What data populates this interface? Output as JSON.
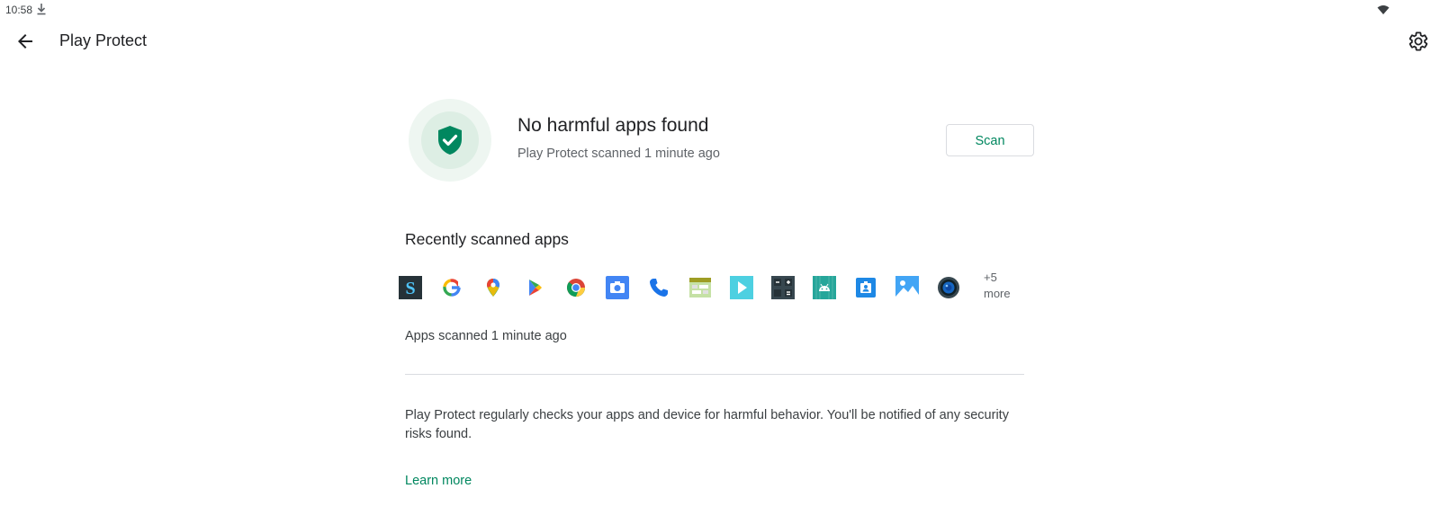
{
  "status_bar": {
    "time": "10:58"
  },
  "app_bar": {
    "title": "Play Protect"
  },
  "status_card": {
    "title": "No harmful apps found",
    "subtitle": "Play Protect scanned 1 minute ago",
    "scan_label": "Scan"
  },
  "recent": {
    "title": "Recently scanned apps",
    "apps": [
      "S-app-icon",
      "google-icon",
      "maps-icon",
      "play-store-icon",
      "chrome-icon",
      "camera-icon",
      "phone-icon",
      "app-icon",
      "video-icon",
      "calculator-icon",
      "android-app-icon",
      "contacts-icon",
      "photos-icon",
      "camera-lens-icon"
    ],
    "more_count": "+5",
    "more_label": "more",
    "scanned_time": "Apps scanned 1 minute ago"
  },
  "description": "Play Protect regularly checks your apps and device for harmful behavior. You'll be notified of any security risks found.",
  "learn_more": "Learn more",
  "colors": {
    "accent": "#01875f",
    "shield": "#01875f"
  }
}
